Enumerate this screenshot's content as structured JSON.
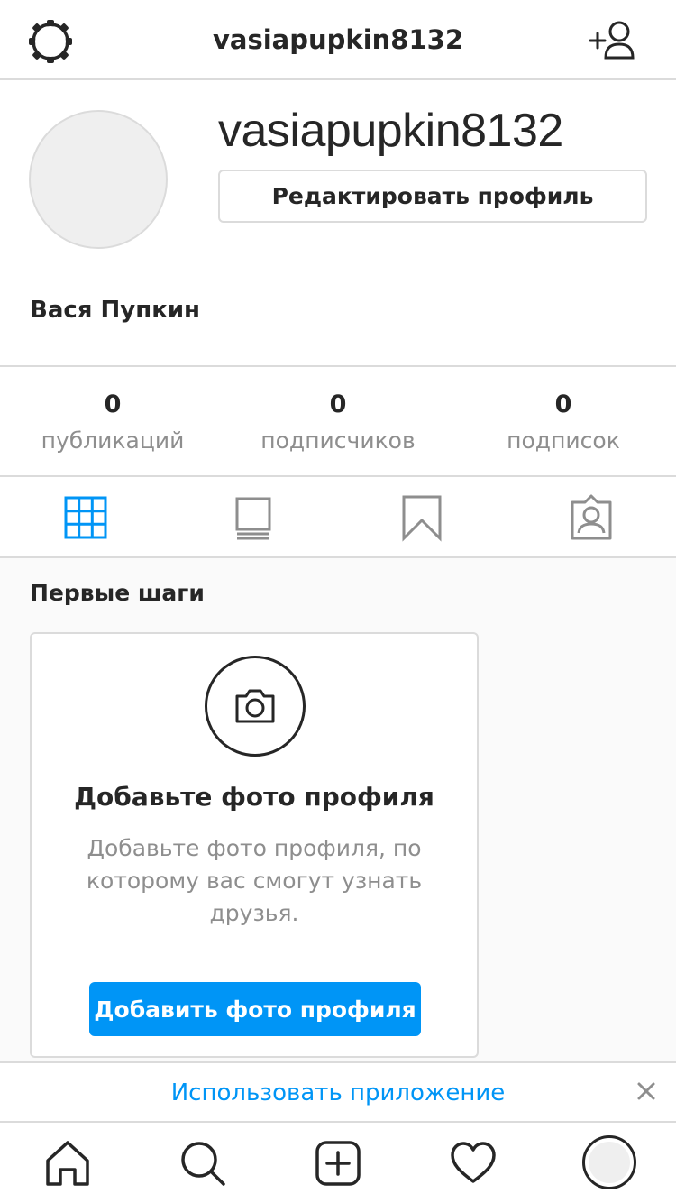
{
  "header": {
    "title": "vasiapupkin8132",
    "settings_icon": "gear-icon",
    "add_user_icon": "add-user-icon"
  },
  "profile": {
    "username": "vasiapupkin8132",
    "edit_button_label": "Редактировать профиль",
    "full_name": "Вася Пупкин"
  },
  "stats": [
    {
      "count": "0",
      "label": "публикаций"
    },
    {
      "count": "0",
      "label": "подписчиков"
    },
    {
      "count": "0",
      "label": "подписок"
    }
  ],
  "tabs": [
    {
      "icon": "grid-icon",
      "active": true
    },
    {
      "icon": "feed-icon",
      "active": false
    },
    {
      "icon": "bookmark-icon",
      "active": false
    },
    {
      "icon": "tagged-icon",
      "active": false
    }
  ],
  "feed": {
    "section_title": "Первые шаги",
    "card": {
      "icon": "camera-icon",
      "title": "Добавьте фото профиля",
      "text": "Добавьте фото профиля, по которому вас смогут узнать друзья.",
      "button_label": "Добавить фото профиля"
    }
  },
  "banner": {
    "link_label": "Использовать приложение",
    "close_icon": "close-icon"
  },
  "bottom_nav": [
    "home-icon",
    "search-icon",
    "new-post-icon",
    "activity-icon",
    "profile-avatar"
  ],
  "colors": {
    "accent": "#0095f6",
    "text": "#262626",
    "secondary": "#8e8e8e",
    "border": "#dbdbdb",
    "background": "#fafafa"
  }
}
